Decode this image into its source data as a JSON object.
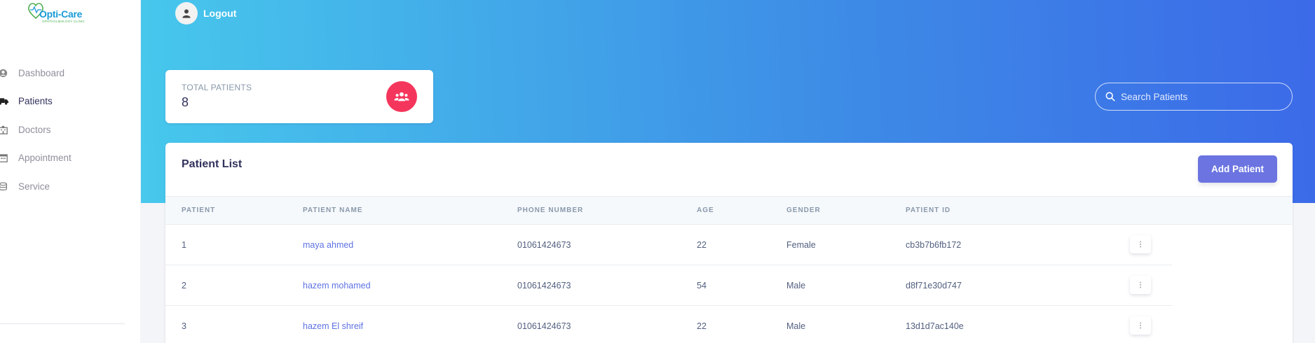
{
  "logo": {
    "name": "Opti-Care",
    "subtitle": "OPHTHALMOLOGY CLINIC"
  },
  "sidebar": {
    "items": [
      {
        "label": "Dashboard",
        "icon": "user-circle-icon",
        "active": false
      },
      {
        "label": "Patients",
        "icon": "ambulance-icon",
        "active": true
      },
      {
        "label": "Doctors",
        "icon": "hospital-icon",
        "active": false
      },
      {
        "label": "Appointment",
        "icon": "calendar-icon",
        "active": false
      },
      {
        "label": "Service",
        "icon": "database-icon",
        "active": false
      }
    ]
  },
  "header": {
    "logout_label": "Logout"
  },
  "stat": {
    "title": "TOTAL PATIENTS",
    "value": "8",
    "icon": "users-icon",
    "color": "#f5365c"
  },
  "search": {
    "placeholder": "Search Patients"
  },
  "list": {
    "title": "Patient List",
    "add_label": "Add Patient",
    "columns": [
      "PATIENT",
      "PATIENT NAME",
      "PHONE NUMBER",
      "AGE",
      "GENDER",
      "PATIENT ID"
    ],
    "rows": [
      {
        "num": "1",
        "name": "maya ahmed",
        "phone": "01061424673",
        "age": "22",
        "gender": "Female",
        "id": "cb3b7b6fb172"
      },
      {
        "num": "2",
        "name": "hazem mohamed",
        "phone": "01061424673",
        "age": "54",
        "gender": "Male",
        "id": "d8f71e30d747"
      },
      {
        "num": "3",
        "name": "hazem El shreif",
        "phone": "01061424673",
        "age": "22",
        "gender": "Male",
        "id": "13d1d7ac140e"
      }
    ]
  },
  "colors": {
    "accent": "#5e72e4",
    "button": "#6b74e0",
    "gradient_start": "#47c8ec",
    "gradient_end": "#3c6ae8"
  }
}
